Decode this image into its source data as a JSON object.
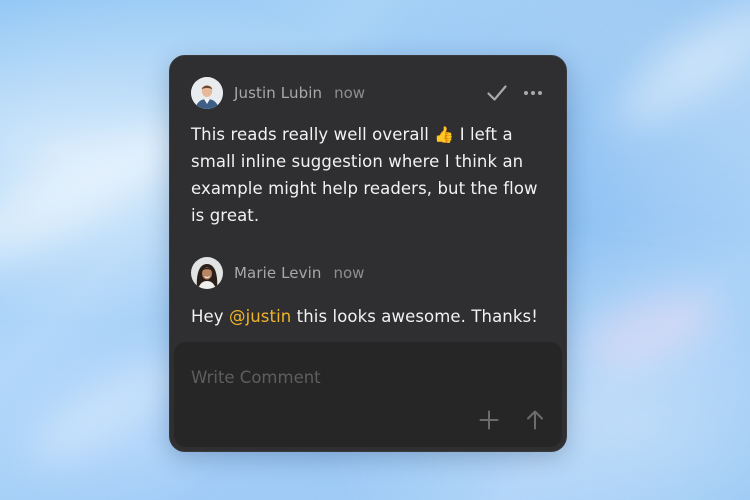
{
  "background": {
    "color": "#8cc4f4"
  },
  "card": {
    "background": "#2f2f31",
    "comments": [
      {
        "author": "Justin Lubin",
        "time": "now",
        "avatar_icon": "avatar-photo-man",
        "text_before_emoji": "This reads really well overall ",
        "emoji": "👍",
        "text_after_emoji": " I left a small inline suggestion where I think an example might help readers, but the flow is great.",
        "actions": {
          "resolve_icon": "checkmark-icon",
          "more_icon": "more-horizontal-icon"
        }
      },
      {
        "author": "Marie Levin",
        "time": "now",
        "avatar_icon": "avatar-photo-woman",
        "text_before_mention": "Hey ",
        "mention": "@justin",
        "text_after_mention": " this looks awesome. Thanks!"
      }
    ],
    "composer": {
      "placeholder": "Write Comment",
      "value": "",
      "add_icon": "plus-icon",
      "send_icon": "arrow-up-icon"
    }
  },
  "colors": {
    "mention": "#f0b429",
    "text": "#f2f2f2",
    "muted": "#a8a8aa"
  }
}
